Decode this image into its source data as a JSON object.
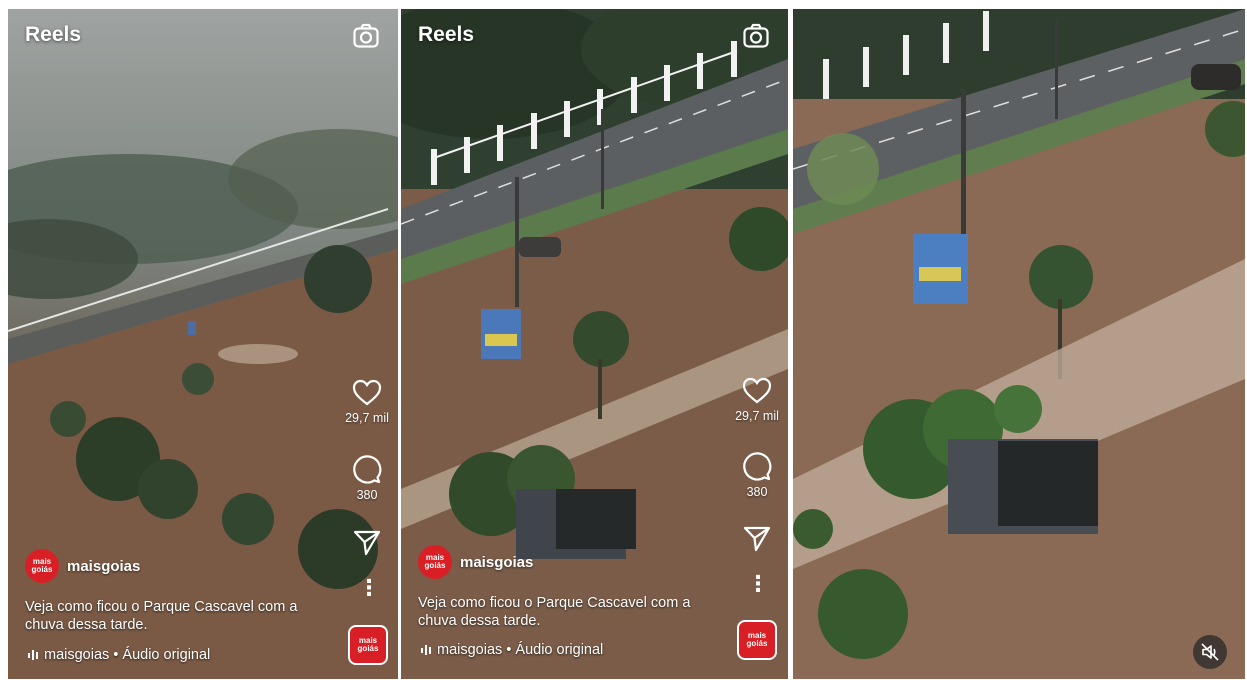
{
  "screens": [
    {
      "header": {
        "title": "Reels"
      },
      "actions": {
        "likes": "29,7 mil",
        "comments": "380"
      },
      "post": {
        "username": "maisgoias",
        "avatar_text": "mais goiás",
        "caption": "Veja como ficou o Parque Cascavel com a chuva dessa tarde.",
        "audio": "maisgoias • Áudio original"
      }
    },
    {
      "header": {
        "title": "Reels"
      },
      "actions": {
        "likes": "29,7 mil",
        "comments": "380"
      },
      "post": {
        "username": "maisgoias",
        "avatar_text": "mais goiás",
        "caption": "Veja como ficou o Parque Cascavel com a chuva dessa tarde.",
        "audio": "maisgoias • Áudio original"
      }
    }
  ],
  "icons": {
    "camera": "camera-icon",
    "like": "heart-icon",
    "comment": "comment-icon",
    "share": "send-icon",
    "more": "more-vertical-icon",
    "audio": "audio-wave-icon",
    "mute": "mute-icon"
  },
  "colors": {
    "brand": "#d81f26",
    "text": "#ffffff"
  }
}
